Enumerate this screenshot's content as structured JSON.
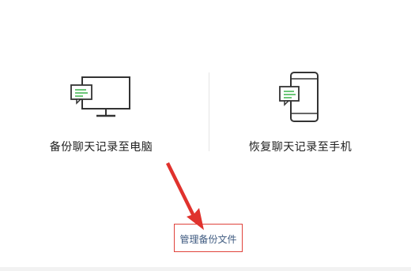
{
  "options": [
    {
      "label": "备份聊天记录至电脑",
      "icon": "monitor-chat-icon"
    },
    {
      "label": "恢复聊天记录至手机",
      "icon": "phone-chat-icon"
    }
  ],
  "manage": {
    "label": "管理备份文件"
  },
  "colors": {
    "highlight_border": "#e0433c",
    "link": "#3f5b80",
    "icon_stroke": "#333333",
    "chat_accent": "#3bb34a"
  }
}
